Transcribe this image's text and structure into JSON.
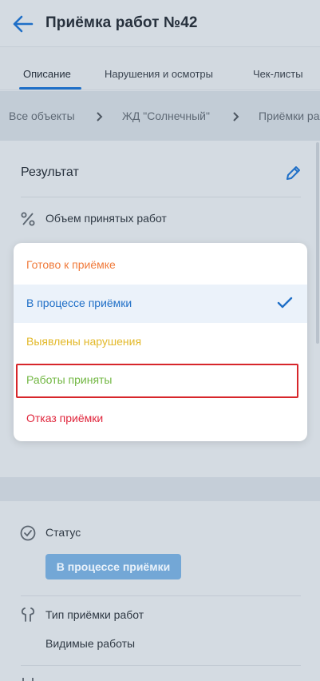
{
  "header": {
    "title": "Приёмка работ №42",
    "back_icon": "arrow-left-icon"
  },
  "tabs": [
    {
      "label": "Описание",
      "active": true
    },
    {
      "label": "Нарушения и осмотры",
      "active": false
    },
    {
      "label": "Чек-листы",
      "active": false
    }
  ],
  "breadcrumb": [
    "Все объекты",
    "ЖД \"Солнечный\"",
    "Приёмки ра"
  ],
  "result": {
    "title": "Результат",
    "edit_icon": "pencil-icon",
    "volume_label": "Объем принятых работ",
    "volume_icon": "percent-icon"
  },
  "dropdown": {
    "options": [
      {
        "label": "Готово к приёмке",
        "color": "#f07a3a",
        "selected": false
      },
      {
        "label": "В процессе приёмки",
        "color": "#1f6fc7",
        "selected": true
      },
      {
        "label": "Выявлены нарушения",
        "color": "#e3b92a",
        "selected": false
      },
      {
        "label": "Работы приняты",
        "color": "#72b743",
        "selected": false
      },
      {
        "label": "Отказ приёмки",
        "color": "#e0263c",
        "selected": false
      }
    ],
    "check_icon": "checkmark-icon"
  },
  "status": {
    "label": "Статус",
    "icon": "check-circle-icon",
    "value": "В процессе приёмки"
  },
  "acceptance_type": {
    "label": "Тип приёмки работ",
    "icon": "wrench-icon",
    "value": "Видимые работы"
  },
  "colors": {
    "accent": "#1f6fc7",
    "status_chip": "#73a7d6",
    "highlight": "#d7262b"
  }
}
